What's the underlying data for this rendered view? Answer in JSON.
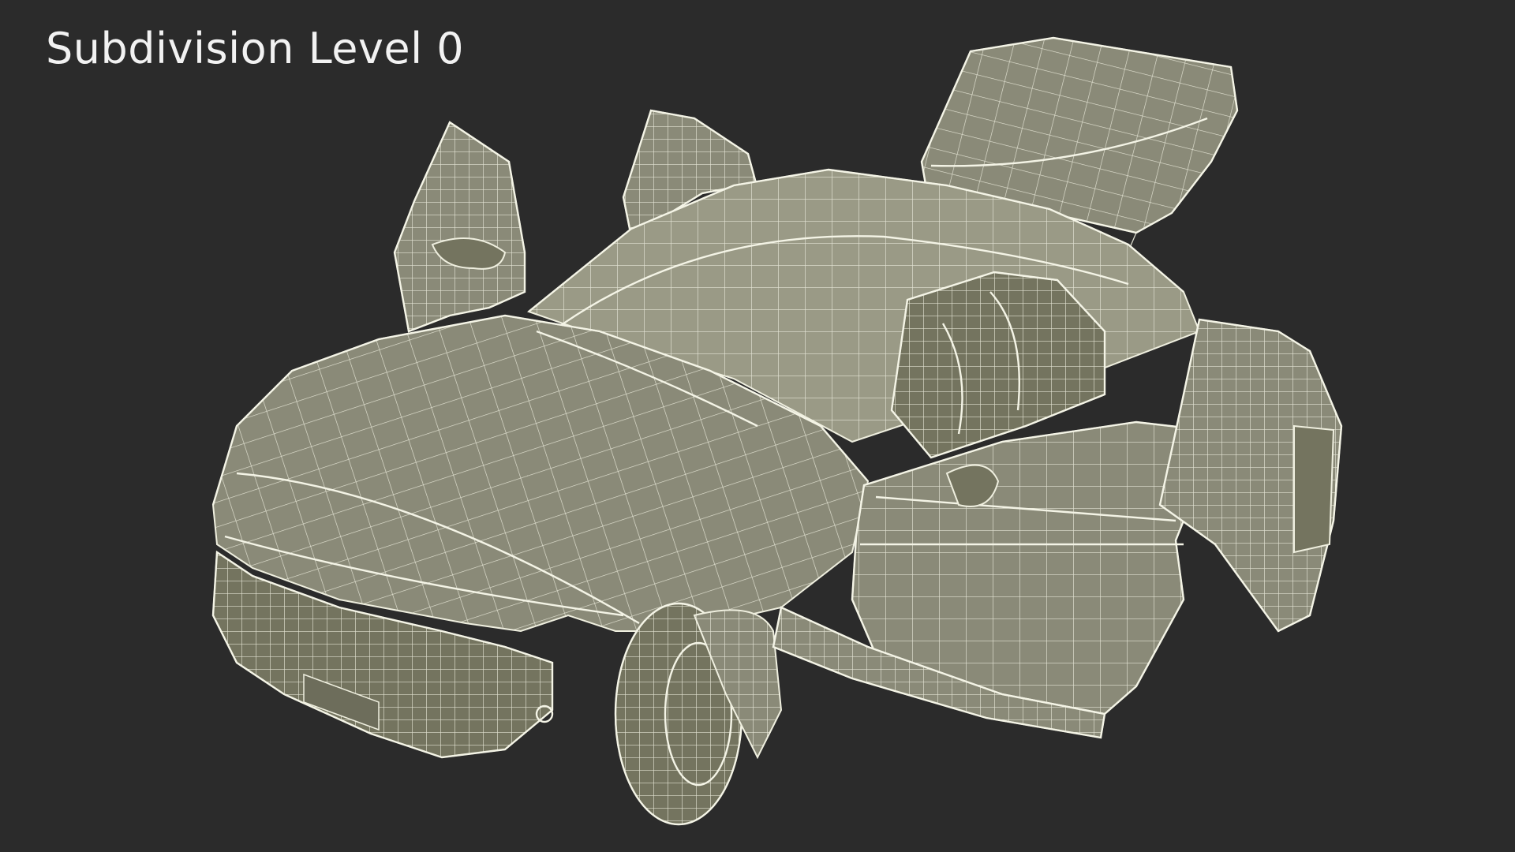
{
  "overlay": {
    "label": "Subdivision Level 0"
  },
  "model": {
    "subject": "car-wireframe-open-doors",
    "surface_color": "#8a8a78",
    "wire_color": "#efefdf",
    "background_color": "#2b2b2b"
  }
}
